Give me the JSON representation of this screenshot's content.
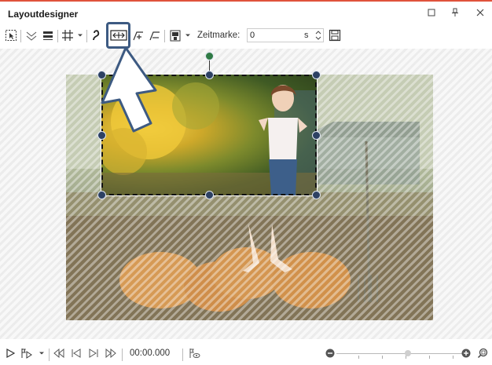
{
  "window": {
    "title": "Layoutdesigner",
    "controls": {
      "minimize_icon": "square-icon",
      "pin_icon": "pin-icon",
      "close_icon": "close-icon"
    }
  },
  "toolbar": {
    "tools": [
      {
        "name": "select-tool-icon"
      },
      {
        "name": "check-fold-icon"
      },
      {
        "name": "align-icon"
      },
      {
        "name": "grid-icon",
        "dropdown": true
      },
      {
        "name": "curve-icon"
      },
      {
        "name": "fit-frame-icon",
        "highlighted": true
      },
      {
        "name": "motion-path-add-icon"
      },
      {
        "name": "motion-path-icon"
      },
      {
        "name": "clipboard-icon",
        "dropdown": true
      },
      {
        "name": "save-icon"
      }
    ],
    "zeitmarke_label": "Zeitmarke:",
    "zeitmarke_value": "0",
    "zeitmarke_unit": "s"
  },
  "playback": {
    "timecode": "00:00.000",
    "zoom_level": 0.56
  },
  "colors": {
    "title_accent": "#e0523c",
    "highlight_border": "#3d5a82",
    "handle_fill": "#2d4163",
    "rotation_handle": "#2f7a45"
  }
}
